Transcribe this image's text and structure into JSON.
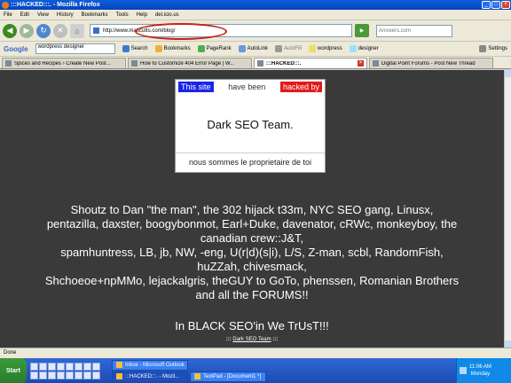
{
  "window": {
    "title": ":::HACKED:::. - Mozilla Firefox"
  },
  "menu": [
    "File",
    "Edit",
    "View",
    "History",
    "Bookmarks",
    "Tools",
    "Help",
    "del.icio.us"
  ],
  "nav": {
    "url": "http://www.mattcutts.com/blog/",
    "search_placeholder": "Answers.com"
  },
  "google_toolbar": {
    "logo": "Google",
    "search_value": "wordpress designer",
    "search_label": "Search",
    "bookmarks_label": "Bookmarks",
    "pagerank_label": "PageRank",
    "autolink_label": "AutoLink",
    "autofill_label": "AutoFill",
    "wordpress_label": "wordpress",
    "designer_label": "designer",
    "settings_label": "Settings"
  },
  "tabs": [
    {
      "label": "Spices and Recipes › Create New Post..."
    },
    {
      "label": "How to Customize 404 Error Page | W..."
    },
    {
      "label": ":::HACKED:::."
    },
    {
      "label": "Digital Point Forums - Post New Thread"
    }
  ],
  "page": {
    "badge_this_site": "This site",
    "badge_have_been": "have been",
    "badge_hacked_by": "hacked by",
    "team": "Dark SEO Team.",
    "proprietaire": "nous sommes le proprietaire de toi",
    "shoutz_lines": [
      "Shoutz to Dan \"the man\", the 302 hijack t33m, NYC SEO gang, Linusx,",
      "pentazilla, daxster, boogybonmot, Earl+Duke, davenator, cRWc, monkeyboy, the",
      "canadian crew::J&T,",
      "spamhuntress, LB, jb, NW, -eng, U(r|d)(s|i), L/S, Z-man, scbl, RandomFish,",
      "huZZah, chivesmack,",
      "Shchoeoe+npMMo, lejackalgris, theGUY to GoTo, phenssen, Romanian Brothers",
      "and all the FORUMS!!"
    ],
    "black_seo": "In BLACK SEO'in We TrUsT!!!",
    "footer_prefix": ":::",
    "footer_link": "Dark SEO Team",
    "footer_suffix": ":::"
  },
  "status": {
    "text": "Done"
  },
  "taskbar": {
    "start_label": "Start",
    "tasks": [
      {
        "label": "Inbox - Microsoft Outlook"
      },
      {
        "label": ":::HACKED:::. - Mozil..."
      },
      {
        "label": "TextPad - [Document1 *]"
      }
    ],
    "clock": "11:06 AM",
    "day": "Monday"
  }
}
